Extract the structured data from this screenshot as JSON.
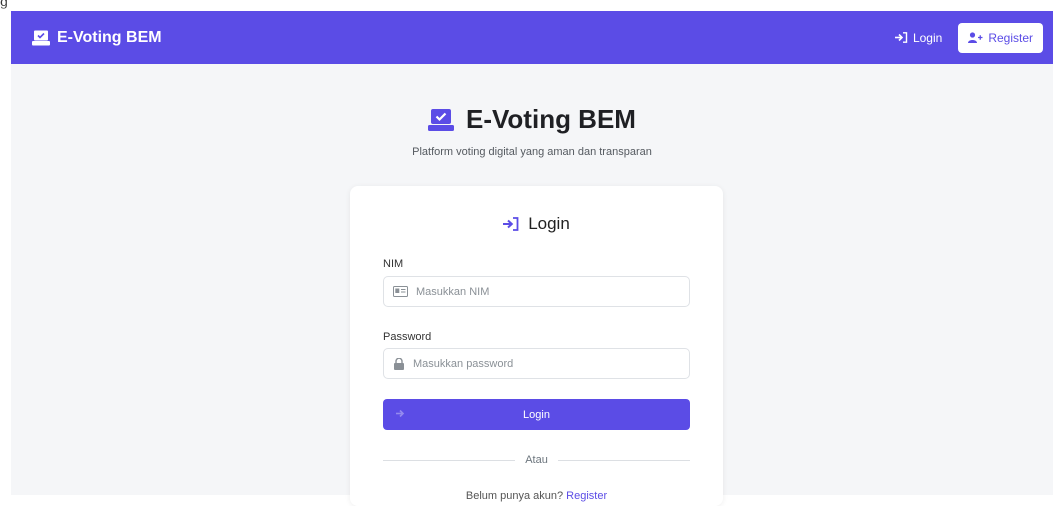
{
  "chrome": {
    "partial_text": "g"
  },
  "navbar": {
    "brand": "E-Voting BEM",
    "login_label": "Login",
    "register_label": "Register"
  },
  "hero": {
    "title": "E-Voting BEM",
    "subtitle": "Platform voting digital yang aman dan transparan"
  },
  "login_card": {
    "title": "Login",
    "nim_label": "NIM",
    "nim_placeholder": "Masukkan NIM",
    "password_label": "Password",
    "password_placeholder": "Masukkan password",
    "submit_label": "Login",
    "divider_text": "Atau",
    "register_prompt": "Belum punya akun?",
    "register_link": "Register"
  },
  "colors": {
    "primary": "#5b4ce6",
    "background": "#f5f6f8",
    "card": "#ffffff"
  },
  "icons": {
    "brand": "ballot-box-icon",
    "login": "sign-in-icon",
    "register": "user-plus-icon",
    "nim": "id-card-icon",
    "password": "lock-icon"
  }
}
